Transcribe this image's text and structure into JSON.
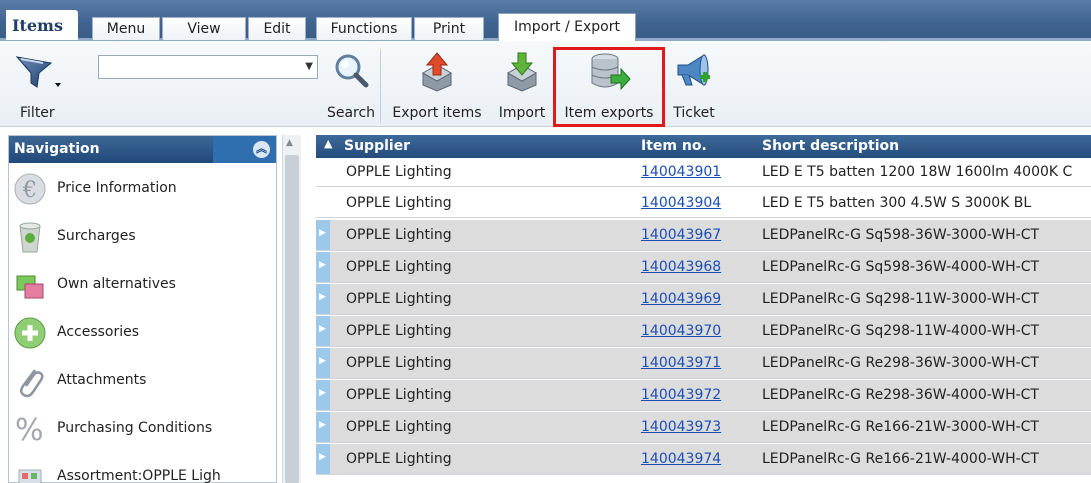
{
  "tabs": {
    "app_title": "Items",
    "items": [
      "Menu",
      "View",
      "Edit",
      "Functions",
      "Print",
      "Import / Export"
    ],
    "active": "Import / Export"
  },
  "toolbar": {
    "filter_label": "Filter",
    "search_value": "",
    "search_label": "Search",
    "export_items_label": "Export items",
    "import_label": "Import",
    "item_exports_label": "Item exports",
    "ticket_label": "Ticket"
  },
  "navigation": {
    "title": "Navigation",
    "items": [
      {
        "label": "Price Information",
        "icon": "euro-icon"
      },
      {
        "label": "Surcharges",
        "icon": "trash-bin-icon"
      },
      {
        "label": "Own alternatives",
        "icon": "alternatives-icon"
      },
      {
        "label": "Accessories",
        "icon": "plus-circle-icon"
      },
      {
        "label": "Attachments",
        "icon": "paperclip-icon"
      },
      {
        "label": "Purchasing Conditions",
        "icon": "percent-icon"
      },
      {
        "label": "Assortment:OPPLE Ligh",
        "icon": "assortment-icon"
      }
    ]
  },
  "grid": {
    "columns": [
      "Supplier",
      "Item no.",
      "Short description"
    ],
    "rows": [
      {
        "supplier": "OPPLE Lighting",
        "item_no": "140043901",
        "description": "LED E T5 batten 1200 18W 1600lm 4000K C"
      },
      {
        "supplier": "OPPLE Lighting",
        "item_no": "140043904",
        "description": "LED E T5 batten 300 4.5W S 3000K BL"
      },
      {
        "supplier": "OPPLE Lighting",
        "item_no": "140043967",
        "description": "LEDPanelRc-G Sq598-36W-3000-WH-CT"
      },
      {
        "supplier": "OPPLE Lighting",
        "item_no": "140043968",
        "description": "LEDPanelRc-G Sq598-36W-4000-WH-CT"
      },
      {
        "supplier": "OPPLE Lighting",
        "item_no": "140043969",
        "description": "LEDPanelRc-G Sq298-11W-3000-WH-CT"
      },
      {
        "supplier": "OPPLE Lighting",
        "item_no": "140043970",
        "description": "LEDPanelRc-G Sq298-11W-4000-WH-CT"
      },
      {
        "supplier": "OPPLE Lighting",
        "item_no": "140043971",
        "description": "LEDPanelRc-G Re298-36W-3000-WH-CT"
      },
      {
        "supplier": "OPPLE Lighting",
        "item_no": "140043972",
        "description": "LEDPanelRc-G Re298-36W-4000-WH-CT"
      },
      {
        "supplier": "OPPLE Lighting",
        "item_no": "140043973",
        "description": "LEDPanelRc-G Re166-21W-3000-WH-CT"
      },
      {
        "supplier": "OPPLE Lighting",
        "item_no": "140043974",
        "description": "LEDPanelRc-G Re166-21W-4000-WH-CT"
      }
    ]
  },
  "colors": {
    "header_blue": "#244c7c",
    "highlight_red": "#e0191c",
    "link_blue": "#1a4fb8",
    "row_marker": "#9cc8ea"
  }
}
